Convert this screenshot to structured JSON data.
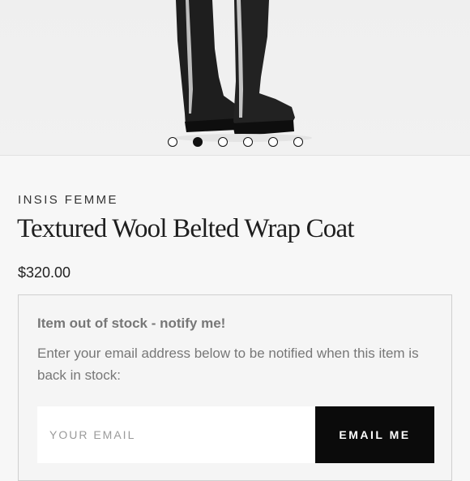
{
  "gallery": {
    "image_alt_icon": "product-photo-boots",
    "slide_count": 6,
    "active_slide": 2
  },
  "product": {
    "brand": "INSIS FEMME",
    "title": "Textured Wool Belted Wrap Coat",
    "price": "$320.00"
  },
  "notify": {
    "heading": "Item out of stock - notify me!",
    "description": "Enter your email address below to be notified when this item is back in stock:",
    "email_placeholder": "YOUR EMAIL",
    "email_value": "",
    "button_label": "EMAIL ME"
  },
  "colors": {
    "button_bg": "#0b0b0b",
    "page_bg": "#f7f7f7"
  }
}
